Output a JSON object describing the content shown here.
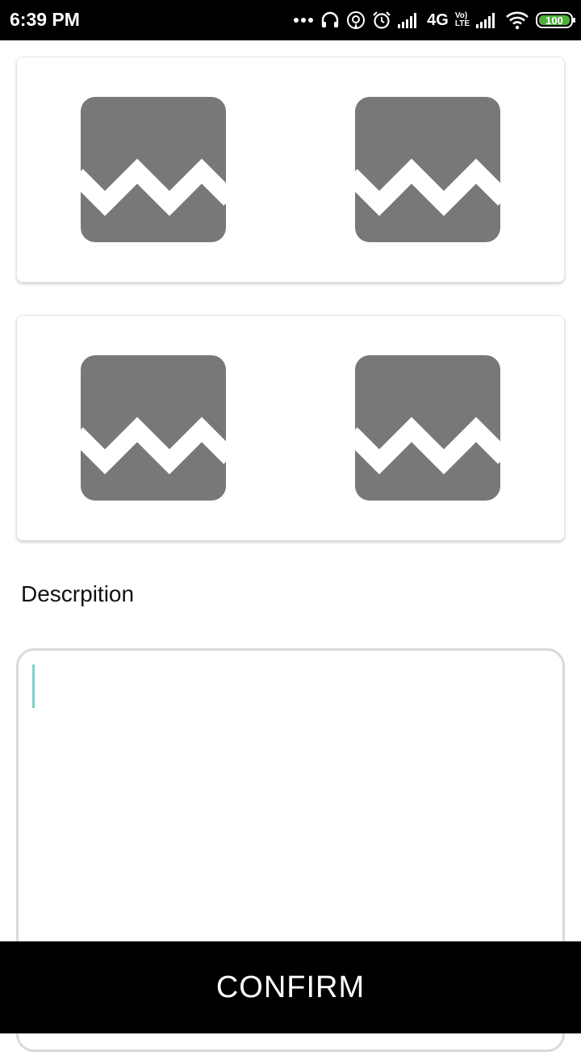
{
  "status_bar": {
    "time": "6:39 PM",
    "network_label": "4G",
    "volte_top": "Vo)",
    "volte_bottom": "LTE",
    "battery_level": "100",
    "icons": [
      "more-dots-icon",
      "headphones-icon",
      "hotspot-icon",
      "alarm-icon",
      "signal-icon",
      "signal-icon",
      "wifi-icon",
      "battery-icon"
    ],
    "battery_color": "#4caf3a"
  },
  "images": {
    "cards": [
      {
        "items": [
          {
            "icon": "broken-image-icon"
          },
          {
            "icon": "broken-image-icon"
          }
        ]
      },
      {
        "items": [
          {
            "icon": "broken-image-icon"
          },
          {
            "icon": "broken-image-icon"
          }
        ]
      }
    ],
    "placeholder_color": "#787878"
  },
  "description": {
    "label": "Descrpition",
    "value": "",
    "cursor_color": "#7fd1c8"
  },
  "footer": {
    "confirm_label": "CONFIRM"
  }
}
